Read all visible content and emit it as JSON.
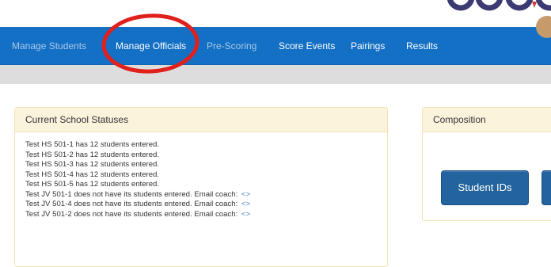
{
  "navbar": {
    "items": [
      {
        "label": "Manage Students"
      },
      {
        "label": "Manage Officials"
      },
      {
        "label": "Pre-Scoring"
      },
      {
        "label": "Score Events"
      },
      {
        "label": "Pairings"
      },
      {
        "label": "Results"
      }
    ],
    "highlighted_item": "Manage Officials",
    "highlight_color": "#e0201b"
  },
  "statuses_panel": {
    "title": "Current School Statuses",
    "lines": [
      {
        "text": "Test HS 501-1 has 12 students entered.",
        "link": ""
      },
      {
        "text": "Test HS 501-2 has 12 students entered.",
        "link": ""
      },
      {
        "text": "Test HS 501-3 has 12 students entered.",
        "link": ""
      },
      {
        "text": "Test HS 501-4 has 12 students entered.",
        "link": ""
      },
      {
        "text": "Test HS 501-5 has 12 students entered.",
        "link": ""
      },
      {
        "text": "Test JV 501-1 does not have its students entered. Email coach:",
        "link": "<>"
      },
      {
        "text": "Test JV 501-4 does not have its students entered. Email coach:",
        "link": "<>"
      },
      {
        "text": "Test JV 501-2 does not have its students entered. Email coach:",
        "link": "<>"
      }
    ]
  },
  "composition_panel": {
    "title": "Composition",
    "student_ids_button": "Student IDs"
  },
  "colors": {
    "navbar": "#1470c4",
    "panel_heading": "#fcf3dd",
    "button": "#23639e",
    "link": "#3d7fd1"
  }
}
